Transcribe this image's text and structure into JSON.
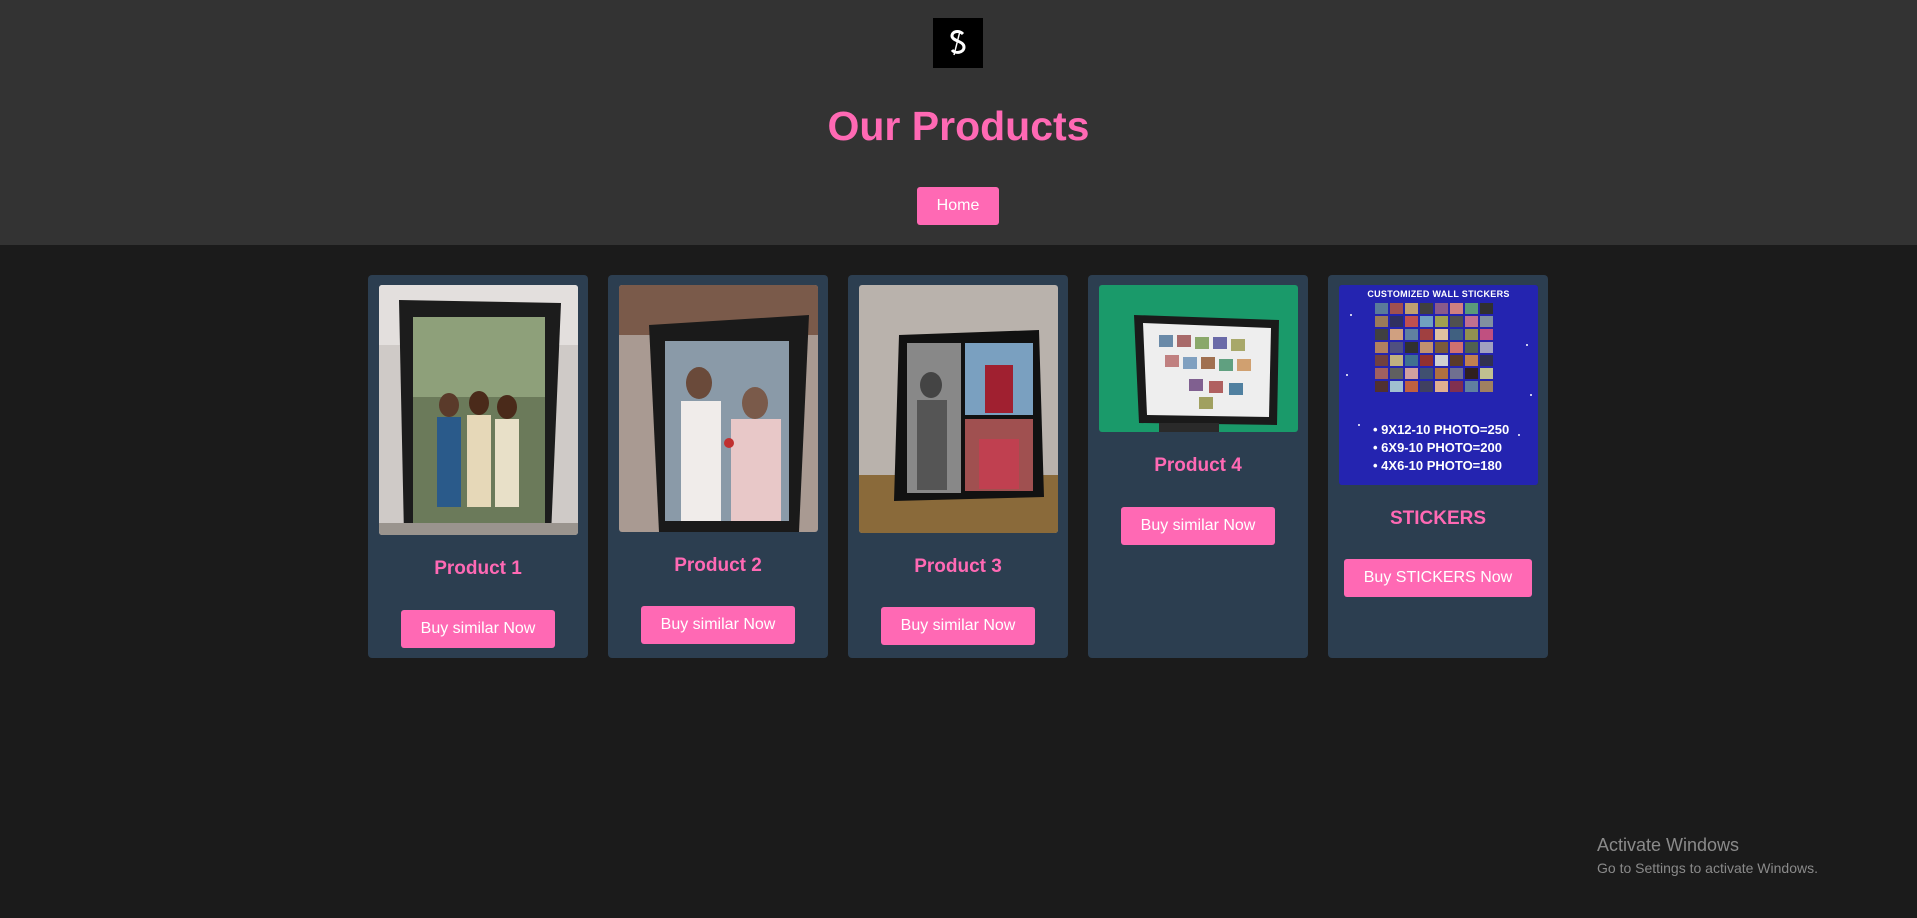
{
  "header": {
    "logo_icon": "s-logo-icon",
    "title": "Our Products",
    "home_label": "Home",
    "accent_color": "#ff69b4"
  },
  "products": [
    {
      "image": "framed-photo-group",
      "title": "Product 1",
      "button": "Buy similar Now"
    },
    {
      "image": "framed-photo-couple",
      "title": "Product 2",
      "button": "Buy similar Now"
    },
    {
      "image": "framed-photo-collage",
      "title": "Product 3",
      "button": "Buy similar Now"
    },
    {
      "image": "framed-photo-grid",
      "title": "Product 4",
      "button": "Buy similar Now"
    },
    {
      "image": "wall-stickers-poster",
      "title": "STICKERS",
      "button": "Buy STICKERS Now",
      "poster": {
        "heading": "CUSTOMIZED WALL STICKERS",
        "prices": [
          "• 9X12-10 PHOTO=250",
          "• 6X9-10 PHOTO=200",
          "• 4X6-10 PHOTO=180"
        ]
      }
    }
  ],
  "watermark": {
    "title": "Activate Windows",
    "subtitle": "Go to Settings to activate Windows."
  }
}
